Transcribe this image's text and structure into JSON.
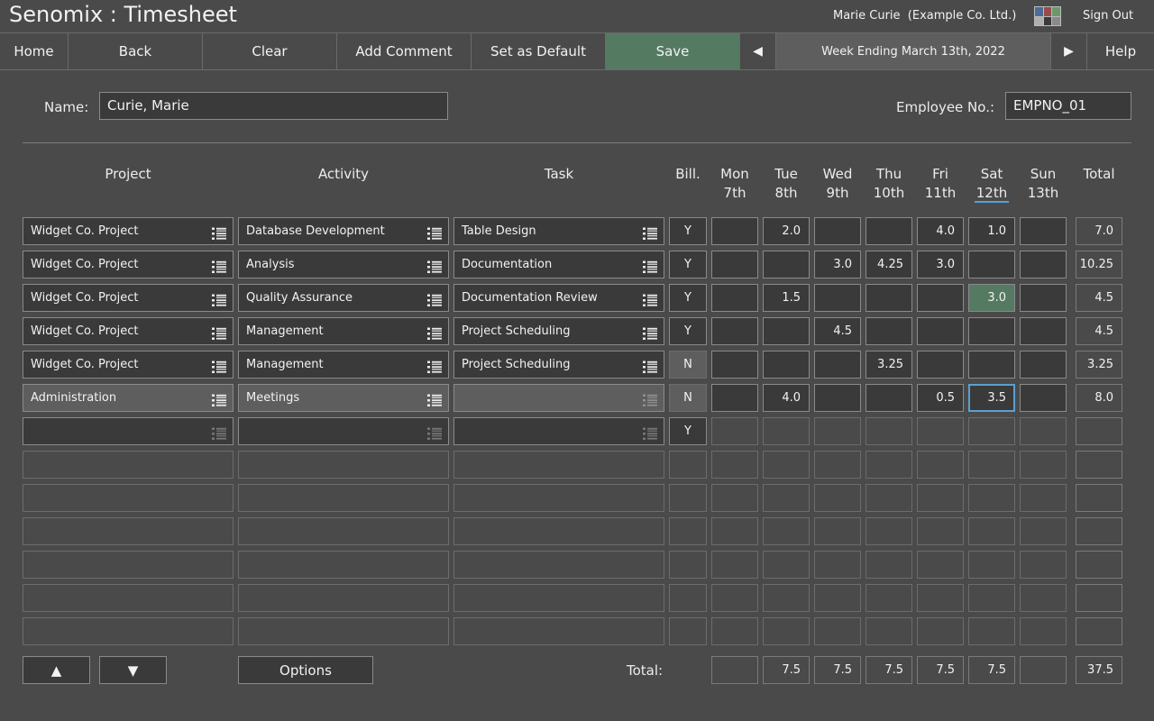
{
  "app": {
    "title": "Senomix : Timesheet",
    "user_info": "Marie Curie  (Example Co. Ltd.)",
    "sign_out": "Sign Out",
    "palette_colors": [
      "#4a6c9a",
      "#9a4a4a",
      "#6a9a6a",
      "#b0b0b0",
      "#3a3a3a",
      "#8a8a8a"
    ]
  },
  "toolbar": {
    "home": "Home",
    "back": "Back",
    "clear": "Clear",
    "add_comment": "Add Comment",
    "set_default": "Set as Default",
    "save": "Save",
    "prev": "◀",
    "week": "Week Ending March 13th, 2022",
    "next": "▶",
    "help": "Help"
  },
  "form": {
    "name_label": "Name:",
    "name_value": "Curie, Marie",
    "emp_label": "Employee No.:",
    "emp_value": "EMPNO_01"
  },
  "headers": {
    "project": "Project",
    "activity": "Activity",
    "task": "Task",
    "bill": "Bill.",
    "total": "Total",
    "days": [
      {
        "name": "Mon",
        "date": "7th"
      },
      {
        "name": "Tue",
        "date": "8th"
      },
      {
        "name": "Wed",
        "date": "9th"
      },
      {
        "name": "Thu",
        "date": "10th"
      },
      {
        "name": "Fri",
        "date": "11th"
      },
      {
        "name": "Sat",
        "date": "12th"
      },
      {
        "name": "Sun",
        "date": "13th"
      }
    ]
  },
  "rows": [
    {
      "project": "Widget Co. Project",
      "activity": "Database Development",
      "task": "Table Design",
      "bill": "Y",
      "hours": [
        "",
        "2.0",
        "",
        "",
        "4.0",
        "1.0",
        ""
      ],
      "total": "7.0"
    },
    {
      "project": "Widget Co. Project",
      "activity": "Analysis",
      "task": "Documentation",
      "bill": "Y",
      "hours": [
        "",
        "",
        "3.0",
        "4.25",
        "3.0",
        "",
        ""
      ],
      "total": "10.25"
    },
    {
      "project": "Widget Co. Project",
      "activity": "Quality Assurance",
      "task": "Documentation Review",
      "bill": "Y",
      "hours": [
        "",
        "1.5",
        "",
        "",
        "",
        "3.0",
        ""
      ],
      "total": "4.5"
    },
    {
      "project": "Widget Co. Project",
      "activity": "Management",
      "task": "Project Scheduling",
      "bill": "Y",
      "hours": [
        "",
        "",
        "4.5",
        "",
        "",
        "",
        ""
      ],
      "total": "4.5"
    },
    {
      "project": "Widget Co. Project",
      "activity": "Management",
      "task": "Project Scheduling",
      "bill": "N",
      "hours": [
        "",
        "",
        "",
        "3.25",
        "",
        "",
        ""
      ],
      "total": "3.25"
    },
    {
      "project": "Administration",
      "activity": "Meetings",
      "task": "",
      "bill": "N",
      "hours": [
        "",
        "4.0",
        "",
        "",
        "0.5",
        "3.5",
        ""
      ],
      "total": "8.0"
    },
    {
      "project": "",
      "activity": "",
      "task": "",
      "bill": "Y",
      "hours": [
        "",
        "",
        "",
        "",
        "",
        "",
        ""
      ],
      "total": ""
    }
  ],
  "footer": {
    "up": "▲",
    "down": "▼",
    "options": "Options",
    "total_label": "Total:",
    "day_totals": [
      "",
      "7.5",
      "7.5",
      "7.5",
      "7.5",
      "7.5",
      ""
    ],
    "grand_total": "37.5"
  }
}
